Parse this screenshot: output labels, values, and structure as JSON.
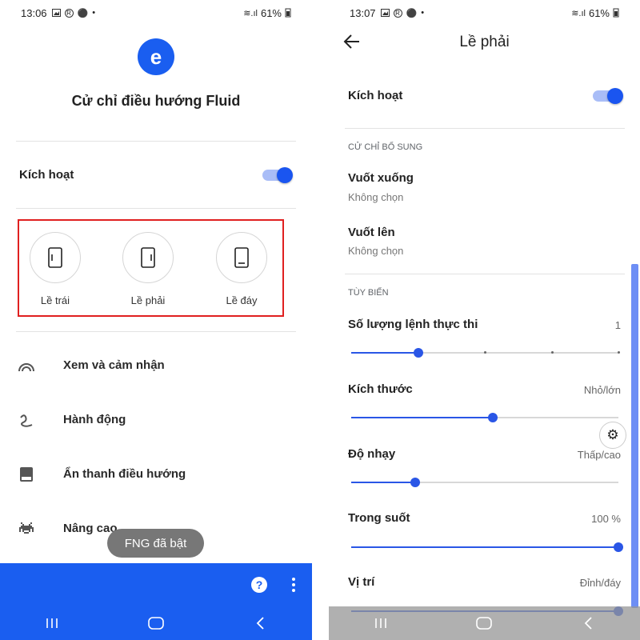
{
  "left": {
    "status": {
      "time": "13:06",
      "battery": "61%"
    },
    "app": {
      "logo_letter": "e",
      "title": "Cử chỉ điều hướng Fluid"
    },
    "enable": {
      "label": "Kích hoạt",
      "on": true
    },
    "edges": [
      {
        "label": "Lề trái",
        "icon": "left-edge-phone-icon"
      },
      {
        "label": "Lề phải",
        "icon": "right-edge-phone-icon"
      },
      {
        "label": "Lề đáy",
        "icon": "bottom-edge-phone-icon"
      }
    ],
    "menu": [
      {
        "label": "Xem và cảm nhận",
        "icon": "rainbow-icon"
      },
      {
        "label": "Hành động",
        "icon": "gesture-icon"
      },
      {
        "label": "Ẩn thanh điều hướng",
        "icon": "navbar-icon"
      },
      {
        "label": "Nâng cao",
        "icon": "space-invader-icon"
      }
    ],
    "toast": "FNG đã bật",
    "bottom_bar": {
      "help": "?",
      "color": "#1a5ef0"
    }
  },
  "right": {
    "status": {
      "time": "13:07",
      "battery": "61%"
    },
    "title": "Lề phải",
    "enable": {
      "label": "Kích hoạt",
      "on": true
    },
    "section_extra": "CỬ CHỈ BỔ SUNG",
    "swipe_down": {
      "title": "Vuốt xuống",
      "value": "Không chọn"
    },
    "swipe_up": {
      "title": "Vuốt lên",
      "value": "Không chọn"
    },
    "section_custom": "TÙY BIẾN",
    "sliders": [
      {
        "title": "Số lượng lệnh thực thi",
        "value": "1",
        "fraction": 0.25,
        "ticks": true
      },
      {
        "title": "Kích thước",
        "value": "Nhỏ/lớn",
        "fraction": 0.53
      },
      {
        "title": "Độ nhạy",
        "value": "Thấp/cao",
        "fraction": 0.24
      },
      {
        "title": "Trong suốt",
        "value": "100 %",
        "fraction": 1.0
      },
      {
        "title": "Vị trí",
        "value": "Đỉnh/đáy",
        "fraction": 1.0
      }
    ]
  }
}
